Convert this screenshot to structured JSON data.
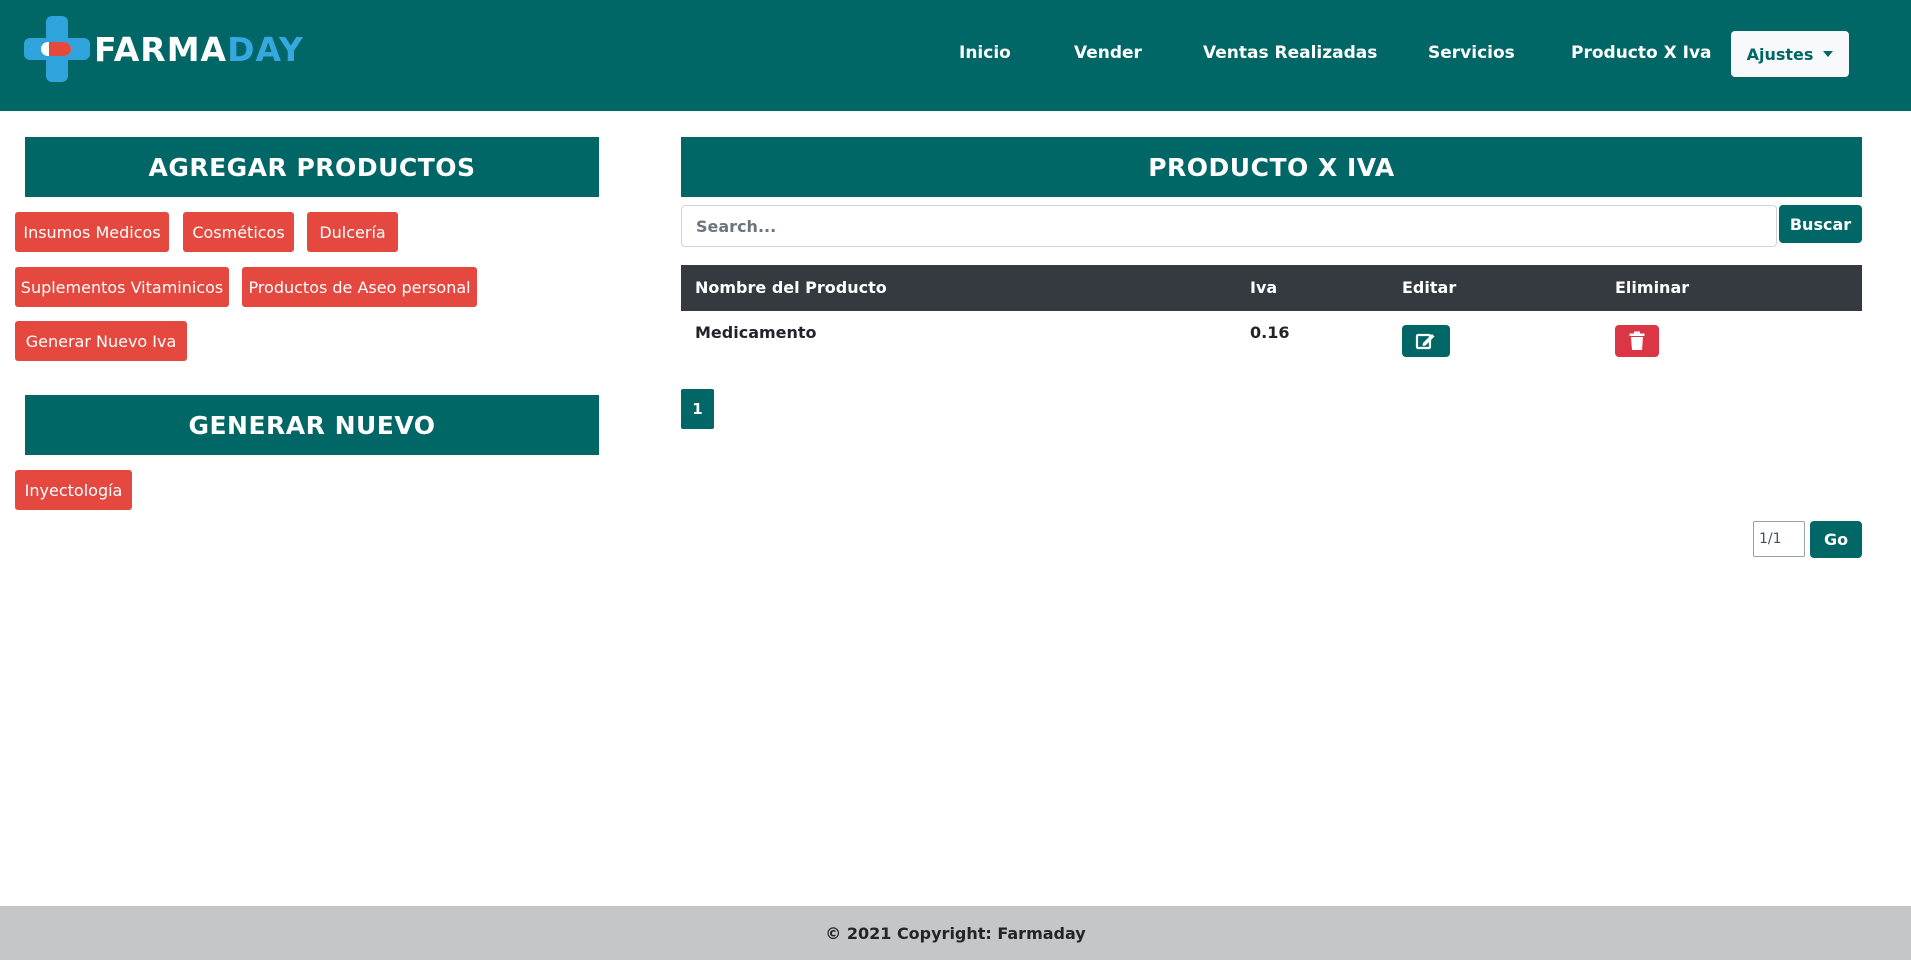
{
  "brand": {
    "part1": "FARMA",
    "part2": "DAY",
    "color_primary": "#006666",
    "color_accent": "#36a8e0"
  },
  "nav": {
    "items": [
      "Inicio",
      "Vender",
      "Ventas Realizadas",
      "Servicios",
      "Producto X Iva"
    ],
    "dropdown_label": "Ajustes"
  },
  "left": {
    "agregar_title": "AGREGAR PRODUCTOS",
    "agregar_buttons": [
      "Insumos Medicos",
      "Cosméticos",
      "Dulcería",
      "Suplementos Vitaminicos",
      "Productos de Aseo personal",
      "Generar Nuevo Iva"
    ],
    "generar_title": "GENERAR NUEVO",
    "generar_buttons": [
      "Inyectología"
    ]
  },
  "main": {
    "title": "PRODUCTO X IVA",
    "search_placeholder": "Search...",
    "search_button": "Buscar",
    "table": {
      "headers": [
        "Nombre del Producto",
        "Iva",
        "Editar",
        "Eliminar"
      ],
      "rows": [
        {
          "nombre": "Medicamento",
          "iva": "0.16"
        }
      ]
    },
    "pagination": {
      "current_page": "1",
      "page_input_value": "1/1",
      "go_label": "Go"
    }
  },
  "footer": {
    "text": "© 2021 Copyright: Farmaday"
  }
}
